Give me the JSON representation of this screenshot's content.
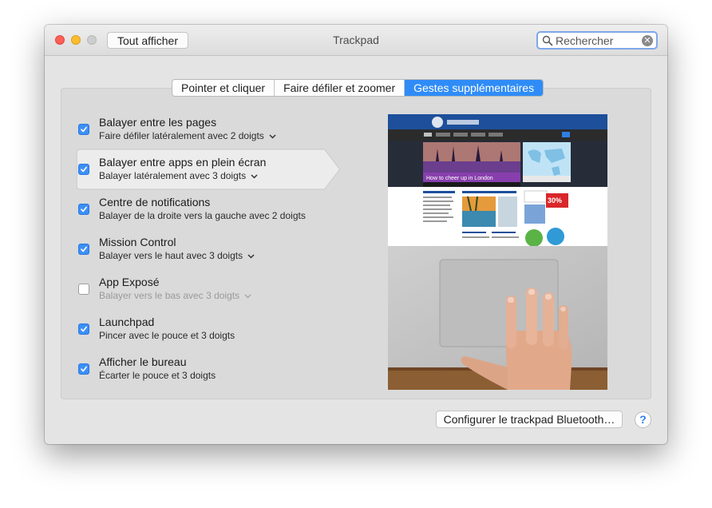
{
  "window": {
    "title": "Trackpad",
    "show_all_label": "Tout afficher"
  },
  "search": {
    "placeholder": "Rechercher",
    "value": ""
  },
  "tabs": [
    {
      "label": "Pointer et cliquer",
      "active": false
    },
    {
      "label": "Faire défiler et zoomer",
      "active": false
    },
    {
      "label": "Gestes supplémentaires",
      "active": true
    }
  ],
  "gestures": [
    {
      "title": "Balayer entre les pages",
      "subtitle": "Faire défiler latéralement avec 2 doigts",
      "checked": true,
      "has_menu": true
    },
    {
      "title": "Balayer entre apps en plein écran",
      "subtitle": "Balayer latéralement avec 3 doigts",
      "checked": true,
      "has_menu": true,
      "selected": true
    },
    {
      "title": "Centre de notifications",
      "subtitle": "Balayer de la droite vers la gauche avec 2 doigts",
      "checked": true,
      "has_menu": false
    },
    {
      "title": "Mission Control",
      "subtitle": "Balayer vers le haut avec 3 doigts",
      "checked": true,
      "has_menu": true
    },
    {
      "title": "App Exposé",
      "subtitle": "Balayer vers le bas avec 3 doigts",
      "checked": false,
      "has_menu": true,
      "disabled": true
    },
    {
      "title": "Launchpad",
      "subtitle": "Pincer avec le pouce et 3 doigts",
      "checked": true,
      "has_menu": false
    },
    {
      "title": "Afficher le bureau",
      "subtitle": "Écarter le pouce et 3 doigts",
      "checked": true,
      "has_menu": false
    }
  ],
  "preview": {
    "headline": "How to cheer up in London",
    "ad_percent": "30%",
    "icon": "trackpad-gesture-video"
  },
  "footer": {
    "bluetooth_label": "Configurer le trackpad Bluetooth…",
    "help_label": "?"
  },
  "colors": {
    "accent": "#2f8cf7",
    "checkbox": "#3b8ff8",
    "window_bg": "#e4e4e4"
  }
}
